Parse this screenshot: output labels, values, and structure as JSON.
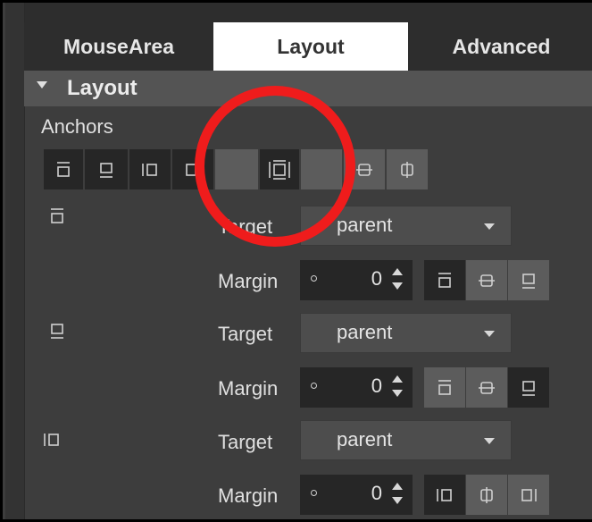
{
  "tabs": [
    {
      "label": "MouseArea",
      "active": false
    },
    {
      "label": "Layout",
      "active": true
    },
    {
      "label": "Advanced",
      "active": false
    }
  ],
  "section": {
    "title": "Layout"
  },
  "anchors_label": "Anchors",
  "anchor_toolbar": [
    {
      "icon": "anchor-top-icon",
      "state": "off"
    },
    {
      "icon": "anchor-bottom-icon",
      "state": "off"
    },
    {
      "icon": "anchor-left-icon",
      "state": "off"
    },
    {
      "icon": "anchor-right-icon",
      "state": "off"
    },
    {
      "icon": "fill-empty",
      "state": "on"
    },
    {
      "icon": "fill-parent-icon",
      "state": "off"
    },
    {
      "icon": "fill-empty-2",
      "state": "on"
    },
    {
      "icon": "vertical-center-icon",
      "state": "on"
    },
    {
      "icon": "horizontal-center-icon",
      "state": "on"
    }
  ],
  "anchor_rows": [
    {
      "side_icon": "anchor-top-icon",
      "target_label": "Target",
      "target_value": "parent",
      "margin_label": "Margin",
      "margin_value": "0",
      "align_buttons": [
        {
          "icon": "align-top-icon",
          "selected": true
        },
        {
          "icon": "align-vcenter-icon",
          "selected": false
        },
        {
          "icon": "align-bottom-icon",
          "selected": false
        }
      ]
    },
    {
      "side_icon": "anchor-bottom-icon",
      "target_label": "Target",
      "target_value": "parent",
      "margin_label": "Margin",
      "margin_value": "0",
      "align_buttons": [
        {
          "icon": "align-top-icon",
          "selected": false
        },
        {
          "icon": "align-vcenter-icon",
          "selected": false
        },
        {
          "icon": "align-bottom-icon",
          "selected": true
        }
      ]
    },
    {
      "side_icon": "anchor-left-icon",
      "target_label": "Target",
      "target_value": "parent",
      "margin_label": "Margin",
      "margin_value": "0",
      "align_buttons": [
        {
          "icon": "align-left-icon",
          "selected": true
        },
        {
          "icon": "align-hcenter-icon",
          "selected": false
        },
        {
          "icon": "align-right-icon",
          "selected": false
        }
      ]
    }
  ],
  "colors": {
    "panel": "#3d3d3d",
    "tab_bar": "#2d2d2d",
    "active_tab": "#ffffff",
    "highlight_circle": "#ef1c1c"
  }
}
